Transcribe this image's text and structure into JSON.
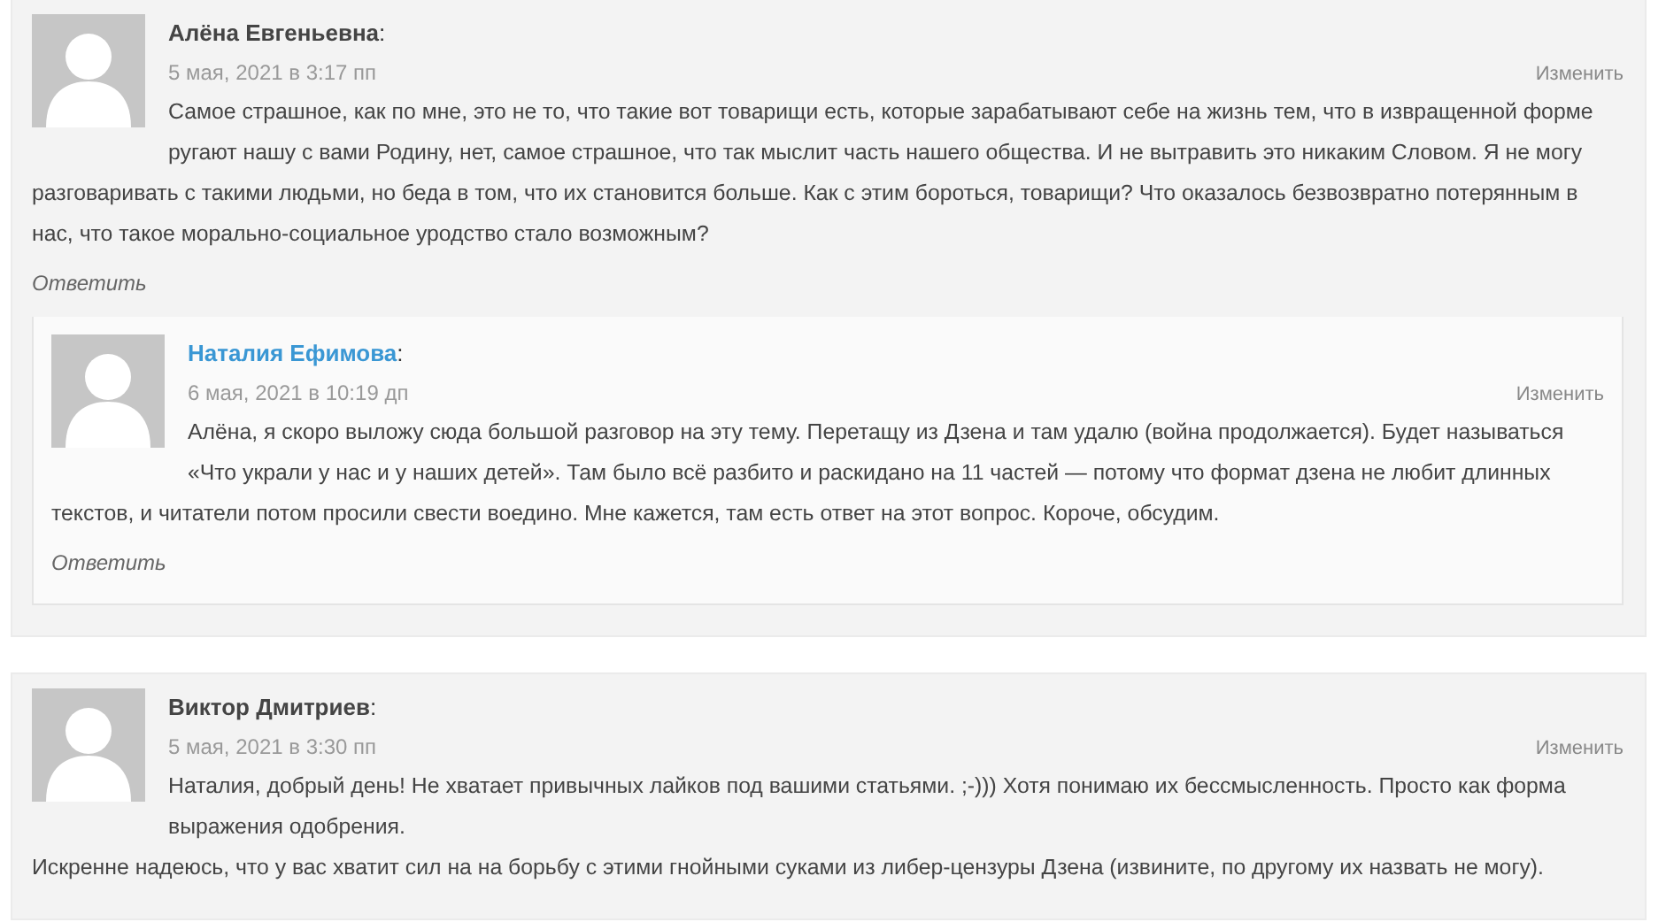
{
  "comments": [
    {
      "author": "Алёна Евгеньевна",
      "author_is_link": false,
      "name_suffix": ":",
      "date": "5 мая, 2021 в 3:17 пп",
      "edit_label": "Изменить",
      "paragraphs": [
        "Самое страшное, как по мне, это не то, что такие вот товарищи есть, которые зарабатывают себе на жизнь тем, что в извращенной форме ругают нашу с вами Родину, нет, самое страшное, что так мыслит часть нашего общества. И не вытравить это никаким Словом. Я не могу разговаривать с такими людьми, но беда в том, что их становится больше. Как с этим бороться, товарищи? Что оказалось безвозвратно потерянным в нас, что такое морально-социальное уродство стало возможным?"
      ],
      "reply_label": "Ответить",
      "replies": [
        {
          "author": "Наталия Ефимова",
          "author_is_link": true,
          "name_suffix": ":",
          "date": "6 мая, 2021 в 10:19 дп",
          "edit_label": "Изменить",
          "paragraphs": [
            "Алёна, я скоро выложу сюда большой разговор на эту тему. Перетащу из Дзена и там удалю (война продолжается). Будет называться «Что украли у нас и у наших детей». Там было всё разбито и раскидано на 11 частей — потому что формат дзена не любит длинных текстов, и читатели потом просили свести воедино. Мне кажется, там есть ответ на этот вопрос. Короче, обсудим."
          ],
          "reply_label": "Ответить"
        }
      ]
    },
    {
      "author": "Виктор Дмитриев",
      "author_is_link": false,
      "name_suffix": ":",
      "date": "5 мая, 2021 в 3:30 пп",
      "edit_label": "Изменить",
      "paragraphs": [
        "Наталия, добрый день! Не хватает привычных лайков под вашими статьями. ;-))) Хотя понимаю их бессмысленность. Просто как форма выражения одобрения.",
        "Искренне надеюсь, что у вас хватит сил на на борьбу с этими гнойными суками из либер-цензуры Дзена (извините, по другому их назвать не могу)."
      ]
    }
  ]
}
